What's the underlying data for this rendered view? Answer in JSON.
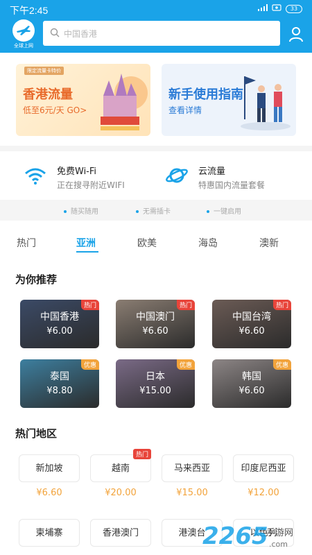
{
  "status_bar": {
    "time": "下午2:45",
    "battery": "33"
  },
  "header": {
    "logo_text": "全球上网",
    "search_placeholder": "中国香港"
  },
  "banners": [
    {
      "title": "香港流量",
      "subtitle": "低至6元/天 GO>",
      "tag": "限定流量卡特价"
    },
    {
      "title": "新手使用指南",
      "subtitle": "查看详情"
    }
  ],
  "features": [
    {
      "title": "免费Wi-Fi",
      "subtitle": "正在搜寻附近WIFI"
    },
    {
      "title": "云流量",
      "subtitle": "特惠国内流量套餐"
    }
  ],
  "benefits": [
    "随买随用",
    "无需插卡",
    "一键启用"
  ],
  "tabs": [
    {
      "label": "热门",
      "active": false
    },
    {
      "label": "亚洲",
      "active": true
    },
    {
      "label": "欧美",
      "active": false
    },
    {
      "label": "海岛",
      "active": false
    },
    {
      "label": "澳新",
      "active": false
    }
  ],
  "recommend": {
    "title": "为你推荐",
    "cards": [
      {
        "name": "中国香港",
        "price": "¥6.00",
        "badge": "热门",
        "badge_type": "hot",
        "color": "#3b4a66"
      },
      {
        "name": "中国澳门",
        "price": "¥6.60",
        "badge": "热门",
        "badge_type": "hot",
        "color": "#8a7d72"
      },
      {
        "name": "中国台湾",
        "price": "¥6.60",
        "badge": "热门",
        "badge_type": "hot",
        "color": "#6b5b55"
      },
      {
        "name": "泰国",
        "price": "¥8.80",
        "badge": "优惠",
        "badge_type": "discount",
        "color": "#3d7f9f"
      },
      {
        "name": "日本",
        "price": "¥15.00",
        "badge": "优惠",
        "badge_type": "discount",
        "color": "#7a6a86"
      },
      {
        "name": "韩国",
        "price": "¥6.60",
        "badge": "优惠",
        "badge_type": "discount",
        "color": "#8c8585"
      }
    ]
  },
  "hot_areas": {
    "title": "热门地区",
    "items": [
      {
        "name": "新加坡",
        "price": "¥6.60",
        "badge": ""
      },
      {
        "name": "越南",
        "price": "¥20.00",
        "badge": "热门"
      },
      {
        "name": "马来西亚",
        "price": "¥15.00",
        "badge": ""
      },
      {
        "name": "印度尼西亚",
        "price": "¥12.00",
        "badge": ""
      },
      {
        "name": "柬埔寨",
        "price": "",
        "badge": ""
      },
      {
        "name": "香港澳门",
        "price": "",
        "badge": ""
      },
      {
        "name": "港澳台",
        "price": "",
        "badge": ""
      },
      {
        "name": "以色列",
        "price": "",
        "badge": ""
      }
    ]
  },
  "watermark": {
    "number": "2265",
    "text": "手游网",
    "url": ".com"
  },
  "colors": {
    "primary": "#1aa3e8",
    "hot": "#e8443a",
    "discount": "#f2a33b"
  }
}
